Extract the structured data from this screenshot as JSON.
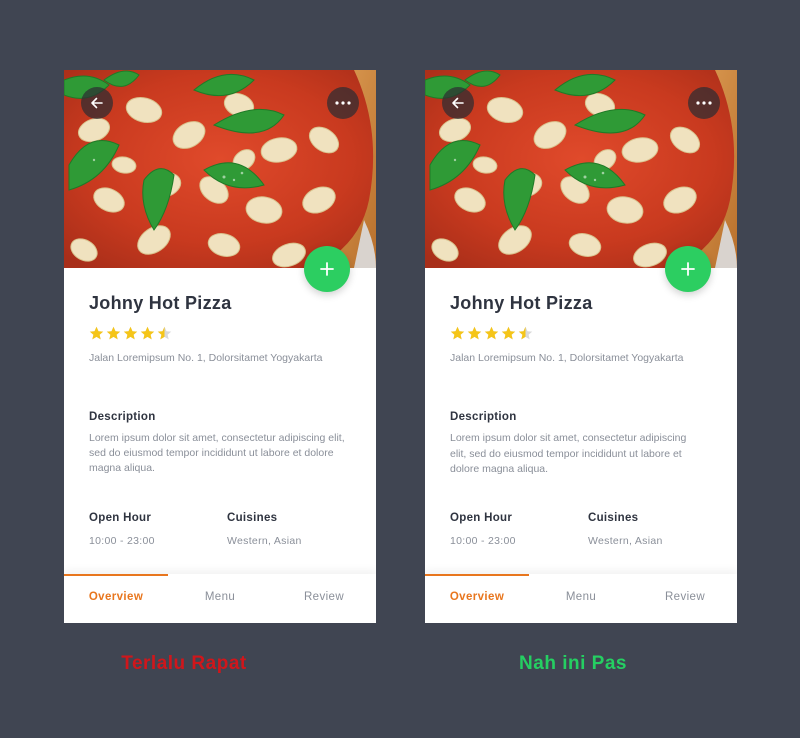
{
  "colors": {
    "background": "#404552",
    "accent_orange": "#e8761e",
    "fab_green": "#2cce61",
    "star_yellow": "#f5c518",
    "caption_bad": "#d0161b",
    "caption_good": "#25cf62"
  },
  "cards": [
    {
      "restaurant_name": "Johny Hot Pizza",
      "rating": 4.5,
      "rating_max": 5,
      "address": "Jalan Loremipsum No. 1, Dolorsitamet Yogyakarta",
      "description_title": "Description",
      "description_text": "Lorem ipsum dolor sit amet, consectetur adipiscing elit, sed do eiusmod tempor incididunt ut labore et dolore magna aliqua.",
      "open_hour_label": "Open Hour",
      "open_hour_value": "10:00 - 23:00",
      "cuisines_label": "Cuisines",
      "cuisines_value": "Western, Asian",
      "tabs": [
        "Overview",
        "Menu",
        "Review"
      ],
      "active_tab": "Overview",
      "icons": {
        "back": "back-arrow-icon",
        "more": "more-dots-icon",
        "add": "plus-icon"
      }
    },
    {
      "restaurant_name": "Johny Hot Pizza",
      "rating": 4.5,
      "rating_max": 5,
      "address": "Jalan Loremipsum No. 1, Dolorsitamet Yogyakarta",
      "description_title": "Description",
      "description_text": "Lorem ipsum dolor sit amet, consectetur adipiscing elit, sed do eiusmod tempor incididunt ut labore et dolore magna aliqua.",
      "open_hour_label": "Open Hour",
      "open_hour_value": "10:00 - 23:00",
      "cuisines_label": "Cuisines",
      "cuisines_value": "Western, Asian",
      "tabs": [
        "Overview",
        "Menu",
        "Review"
      ],
      "active_tab": "Overview",
      "icons": {
        "back": "back-arrow-icon",
        "more": "more-dots-icon",
        "add": "plus-icon"
      }
    }
  ],
  "captions": {
    "left": "Terlalu Rapat",
    "right": "Nah ini Pas"
  }
}
